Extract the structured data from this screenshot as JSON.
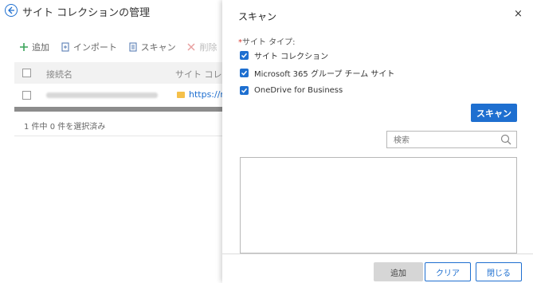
{
  "page": {
    "title": "サイト コレクションの管理"
  },
  "toolbar": {
    "add": "追加",
    "import": "インポート",
    "scan": "スキャン",
    "delete": "削除"
  },
  "table": {
    "headers": [
      "接続名",
      "サイト コレクション"
    ],
    "rows": [
      {
        "name_blurred": "",
        "url": "https://m"
      }
    ],
    "selection_summary": "1 件中 0 件を選択済み"
  },
  "panel": {
    "title": "スキャン",
    "close_symbol": "×",
    "site_type_label": "サイト タイプ:",
    "required_mark": "*",
    "options": [
      {
        "label": "サイト コレクション",
        "checked": true
      },
      {
        "label": "Microsoft 365 グループ チーム サイト",
        "checked": true
      },
      {
        "label": "OneDrive for Business",
        "checked": true
      }
    ],
    "scan_button": "スキャン",
    "search_placeholder": "検索",
    "footer": {
      "add": "追加",
      "clear": "クリア",
      "close": "閉じる"
    }
  },
  "colors": {
    "accent": "#1e6fd0",
    "required": "#d9342b",
    "folder": "#f5c04a"
  },
  "icons": [
    "back-arrow-icon",
    "plus-icon",
    "import-icon",
    "scan-icon",
    "delete-icon",
    "folder-icon",
    "search-icon",
    "check-icon",
    "close-icon"
  ]
}
